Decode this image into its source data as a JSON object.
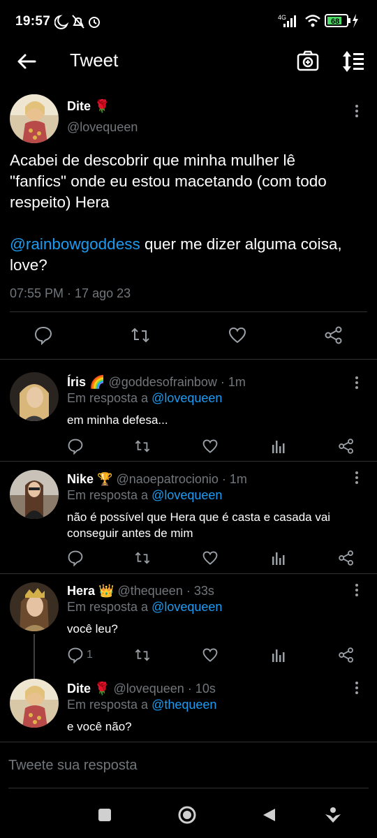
{
  "status": {
    "time": "19:57",
    "battery": "68",
    "network": "4G"
  },
  "header": {
    "title": "Tweet"
  },
  "tweet": {
    "name": "Dite",
    "emoji": "🌹",
    "handle": "@lovequeen",
    "line1": "Acabei de descobrir que minha mulher lê",
    "line2": "\"fanfics\" onde eu estou macetando (com todo",
    "line3": "respeito) Hera",
    "mention": "@rainbowgoddess",
    "line4_rest": " quer me dizer alguma coisa,",
    "line5": "love?",
    "timestamp": "07:55 PM · 17 ago 23"
  },
  "replies": [
    {
      "name": "Íris",
      "emoji": "🌈",
      "handle": "@goddesofrainbow · 1m",
      "inreply_label": "Em resposta a",
      "inreply_to": "@lovequeen",
      "lines": [
        "em minha defesa..."
      ],
      "reply_count": ""
    },
    {
      "name": "Nike",
      "emoji": "🏆",
      "handle": "@naoepatrocionio · 1m",
      "inreply_label": "Em resposta a",
      "inreply_to": "@lovequeen",
      "lines": [
        "não é possível que Hera que é casta e casada vai",
        "conseguir antes de mim"
      ],
      "reply_count": ""
    },
    {
      "name": "Hera",
      "emoji": "👑",
      "handle": "@thequeen · 33s",
      "inreply_label": "Em resposta a",
      "inreply_to": "@lovequeen",
      "lines": [
        "você leu?"
      ],
      "reply_count": "1"
    },
    {
      "name": "Dite",
      "emoji": "🌹",
      "handle": "@lovequeen · 10s",
      "inreply_label": "Em resposta a",
      "inreply_to": "@thequeen",
      "lines": [
        "e você não?"
      ],
      "reply_count": ""
    }
  ],
  "compose": {
    "placeholder": "Tweete sua resposta"
  },
  "colors": {
    "accent": "#1d9bf0",
    "muted": "#71767b",
    "background": "#000000"
  }
}
